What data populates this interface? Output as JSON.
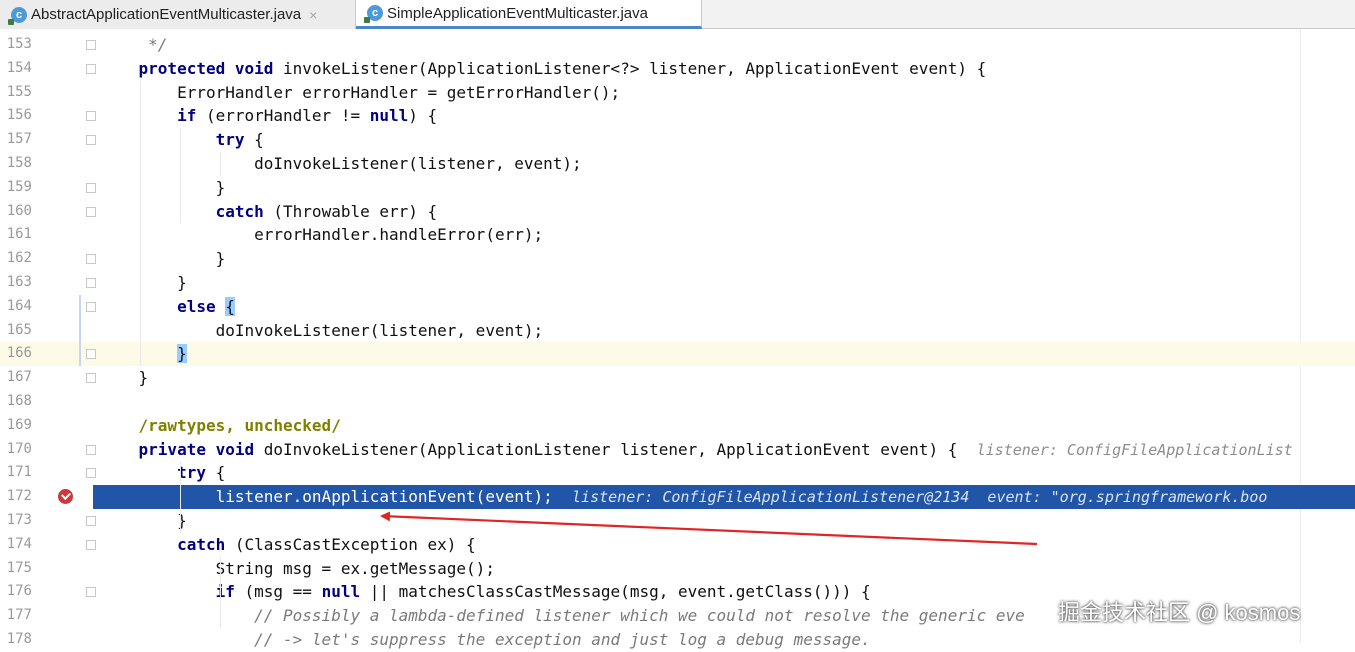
{
  "tabs": [
    {
      "label": "AbstractApplicationEventMulticaster.java",
      "icon": "class-c-icon",
      "active": false,
      "close": "×"
    },
    {
      "label": "SimpleApplicationEventMulticaster.java",
      "icon": "class-c-icon",
      "active": true
    }
  ],
  "editor": {
    "lines": [
      {
        "num": "153",
        "text": "     */"
      },
      {
        "num": "154",
        "text": "    protected void invokeListener(ApplicationListener<?> listener, ApplicationEvent event) {"
      },
      {
        "num": "155",
        "text": "        ErrorHandler errorHandler = getErrorHandler();"
      },
      {
        "num": "156",
        "text": "        if (errorHandler != null) {"
      },
      {
        "num": "157",
        "text": "            try {"
      },
      {
        "num": "158",
        "text": "                doInvokeListener(listener, event);"
      },
      {
        "num": "159",
        "text": "            }"
      },
      {
        "num": "160",
        "text": "            catch (Throwable err) {"
      },
      {
        "num": "161",
        "text": "                errorHandler.handleError(err);"
      },
      {
        "num": "162",
        "text": "            }"
      },
      {
        "num": "163",
        "text": "        }"
      },
      {
        "num": "164",
        "text": "        else {"
      },
      {
        "num": "165",
        "text": "            doInvokeListener(listener, event);"
      },
      {
        "num": "166",
        "text": "        }"
      },
      {
        "num": "167",
        "text": "    }"
      },
      {
        "num": "168",
        "text": ""
      },
      {
        "num": "169",
        "text": "    /rawtypes, unchecked/"
      },
      {
        "num": "170",
        "text": "    private void doInvokeListener(ApplicationListener listener, ApplicationEvent event) {",
        "hint": "listener: ConfigFileApplicationList"
      },
      {
        "num": "171",
        "text": "        try {"
      },
      {
        "num": "172",
        "text": "            listener.onApplicationEvent(event);",
        "hint": "listener: ConfigFileApplicationListener@2134  event: \"org.springframework.boo"
      },
      {
        "num": "173",
        "text": "        }"
      },
      {
        "num": "174",
        "text": "        catch (ClassCastException ex) {"
      },
      {
        "num": "175",
        "text": "            String msg = ex.getMessage();"
      },
      {
        "num": "176",
        "text": "            if (msg == null || matchesClassCastMessage(msg, event.getClass())) {"
      },
      {
        "num": "177",
        "text": "                // Possibly a lambda-defined listener which we could not resolve the generic eve"
      },
      {
        "num": "178",
        "text": "                // -> let's suppress the exception and just log a debug message."
      }
    ],
    "current_line": "166",
    "execution_line": "172",
    "breakpoint_line": "172"
  },
  "watermark": "掘金技术社区 @ kosmos",
  "colors": {
    "keyword": "#000080",
    "comment": "#7a7a7a",
    "annotation": "#808000",
    "execution_highlight": "#2155a8",
    "current_line": "#fdfbe8",
    "arrow": "#e02525",
    "breakpoint": "#d2363b"
  }
}
